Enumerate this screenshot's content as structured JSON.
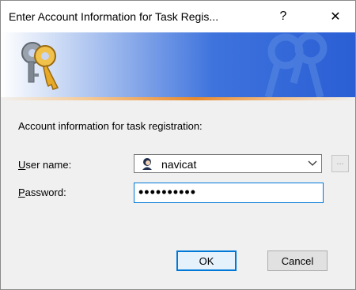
{
  "window": {
    "title": "Enter Account Information for Task Regis...",
    "help_glyph": "?",
    "close_glyph": "✕"
  },
  "banner": {
    "icon": "keys-icon",
    "accent_colors": [
      "#2a5ed4",
      "#e8892b"
    ]
  },
  "form": {
    "intro": "Account information for task registration:",
    "user_label_key": "U",
    "user_label_rest": "ser name:",
    "user_value": "navicat",
    "user_icon": "user-avatar-icon",
    "ellipsis_label": "...",
    "password_label_key": "P",
    "password_label_rest": "assword:",
    "password_mask": "••••••••••"
  },
  "buttons": {
    "ok": "OK",
    "cancel": "Cancel"
  }
}
